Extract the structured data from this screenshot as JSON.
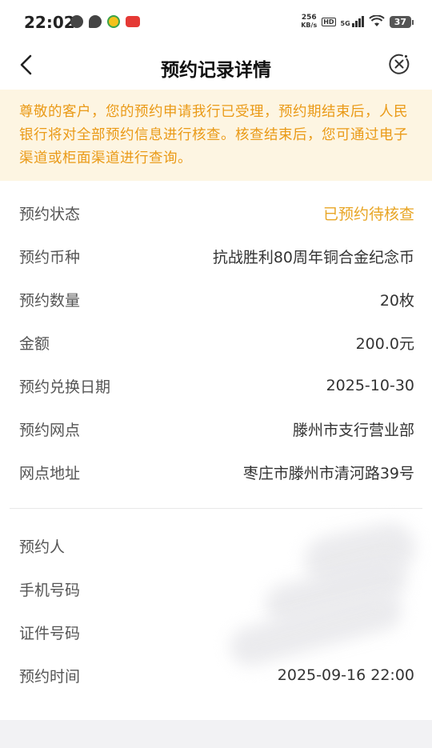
{
  "status_bar": {
    "time": "22:02",
    "net_speed_value": "256",
    "net_speed_unit": "KB/s",
    "hd_label": "HD",
    "network_label": "5G",
    "battery": "37"
  },
  "nav": {
    "title": "预约记录详情"
  },
  "notice": {
    "text": "尊敬的客户，您的预约申请我行已受理，预约期结束后，人民银行将对全部预约信息进行核查。核查结束后，您可通过电子渠道或柜面渠道进行查询。"
  },
  "details": [
    {
      "label": "预约状态",
      "value": "已预约待核查"
    },
    {
      "label": "预约币种",
      "value": "抗战胜利80周年铜合金纪念币"
    },
    {
      "label": "预约数量",
      "value": "20枚"
    },
    {
      "label": "金额",
      "value": "200.0元"
    },
    {
      "label": "预约兑换日期",
      "value": "2025-10-30"
    },
    {
      "label": "预约网点",
      "value": "滕州市支行营业部"
    },
    {
      "label": "网点地址",
      "value": "枣庄市滕州市清河路39号"
    }
  ],
  "personal": [
    {
      "label": "预约人",
      "value": ""
    },
    {
      "label": "手机号码",
      "value": ""
    },
    {
      "label": "证件号码",
      "value": ""
    },
    {
      "label": "预约时间",
      "value": "2025-09-16 22:00"
    }
  ],
  "colors": {
    "accent": "#e8a524",
    "notice_bg": "#fdf5e2",
    "notice_text": "#ea9a17"
  }
}
